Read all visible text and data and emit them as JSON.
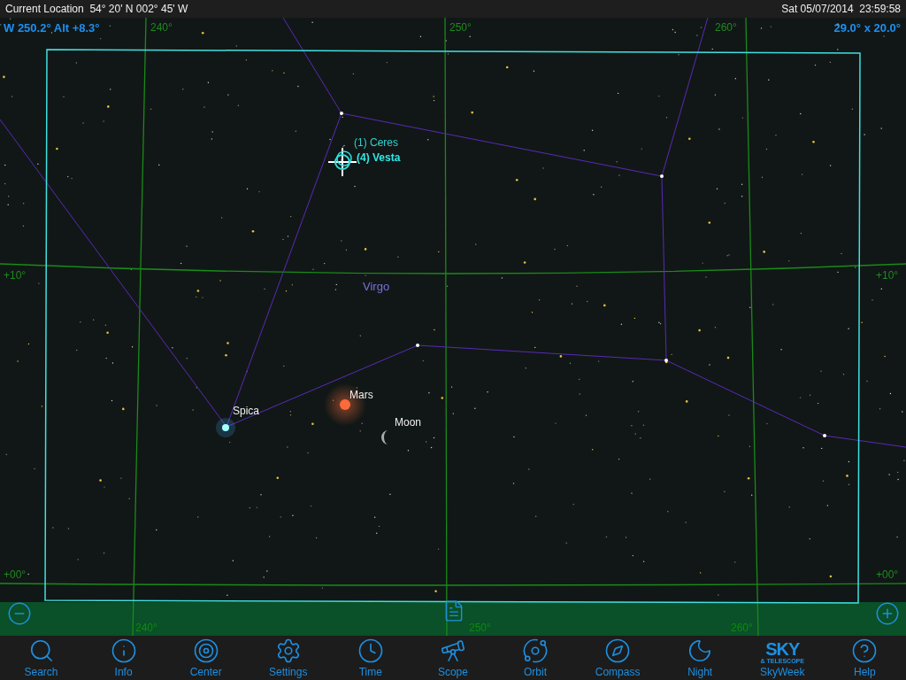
{
  "status_bar": {
    "location": "Current Location  54° 20' N 002° 45' W",
    "datetime": "Sat 05/07/2014  23:59:58"
  },
  "sky_map": {
    "heading": "W 250.2° Alt +8.3°",
    "field_of_view": "29.0° x 20.0°",
    "grid_labels": [
      {
        "text": "240°"
      },
      {
        "text": "250°"
      },
      {
        "text": "260°"
      },
      {
        "text": "+10°"
      },
      {
        "text": "+00°"
      },
      {
        "text": "+10°"
      },
      {
        "text": "+00°"
      },
      {
        "text": "240°"
      },
      {
        "text": "250°"
      },
      {
        "text": "260°"
      }
    ],
    "objects": [
      {
        "kind": "asteroid",
        "label": "(1) Ceres",
        "selected": false
      },
      {
        "kind": "asteroid",
        "label": "(4) Vesta",
        "selected": true
      },
      {
        "kind": "constellation",
        "label": "Virgo"
      },
      {
        "kind": "planet",
        "label": "Mars"
      },
      {
        "kind": "star",
        "label": "Spica"
      },
      {
        "kind": "moon",
        "label": "Moon"
      }
    ]
  },
  "toolbar": [
    {
      "label": "Search"
    },
    {
      "label": "Info"
    },
    {
      "label": "Center"
    },
    {
      "label": "Settings"
    },
    {
      "label": "Time"
    },
    {
      "label": "Scope"
    },
    {
      "label": "Orbit"
    },
    {
      "label": "Compass"
    },
    {
      "label": "Night"
    },
    {
      "label": "SkyWeek",
      "logo": {
        "title": "SKY",
        "subtitle": "& TELESCOPE"
      }
    },
    {
      "label": "Help"
    }
  ]
}
